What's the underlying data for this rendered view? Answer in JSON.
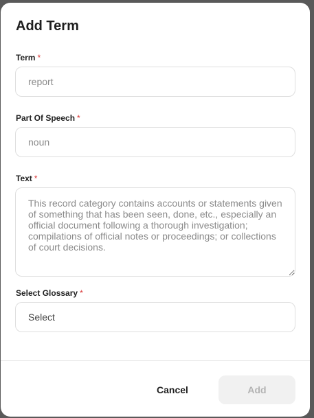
{
  "dialog": {
    "title": "Add Term",
    "required_marker": "*"
  },
  "form": {
    "term": {
      "label": "Term",
      "placeholder": "report",
      "value": ""
    },
    "part_of_speech": {
      "label": "Part Of Speech",
      "placeholder": "noun",
      "value": ""
    },
    "text": {
      "label": "Text",
      "placeholder": "This record category contains accounts or statements given of something that has been seen, done, etc., especially an official document following a thorough investigation; compilations of official notes or proceedings; or collections of court decisions.",
      "value": ""
    },
    "glossary": {
      "label": "Select Glossary",
      "selected": "Select"
    }
  },
  "actions": {
    "cancel_label": "Cancel",
    "add_label": "Add"
  },
  "colors": {
    "required": "#d93636",
    "add_button_disabled_bg": "#f1f1f1",
    "add_button_disabled_text": "#b3b3b3"
  }
}
